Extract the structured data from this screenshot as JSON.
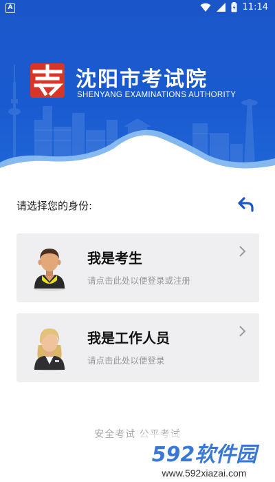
{
  "status_bar": {
    "notification_icon": "A",
    "time": "11:14",
    "icons": [
      "wifi-icon",
      "signal-icon",
      "battery-icon"
    ]
  },
  "header": {
    "title": "沈阳市考试院",
    "subtitle": "SHENYANG EXAMINATIONS AUTHORITY",
    "logo_char": "考"
  },
  "prompt": {
    "text": "请选择您的身份:",
    "back_icon": "back-arrow-icon"
  },
  "cards": [
    {
      "title": "我是考生",
      "subtitle": "请点击此处以便登录或注册",
      "avatar": "male-student-avatar"
    },
    {
      "title": "我是工作人员",
      "subtitle": "请点击此处以便登录",
      "avatar": "female-staff-avatar"
    }
  ],
  "footer": {
    "slogan": "安全考试 公平考试"
  },
  "watermark": {
    "brand": "592软件园",
    "url": "www.592xiazai.com"
  },
  "colors": {
    "primary": "#1a56c8",
    "card_bg": "#efeff1",
    "subtext": "#999999",
    "logo_red": "#d8342a"
  }
}
